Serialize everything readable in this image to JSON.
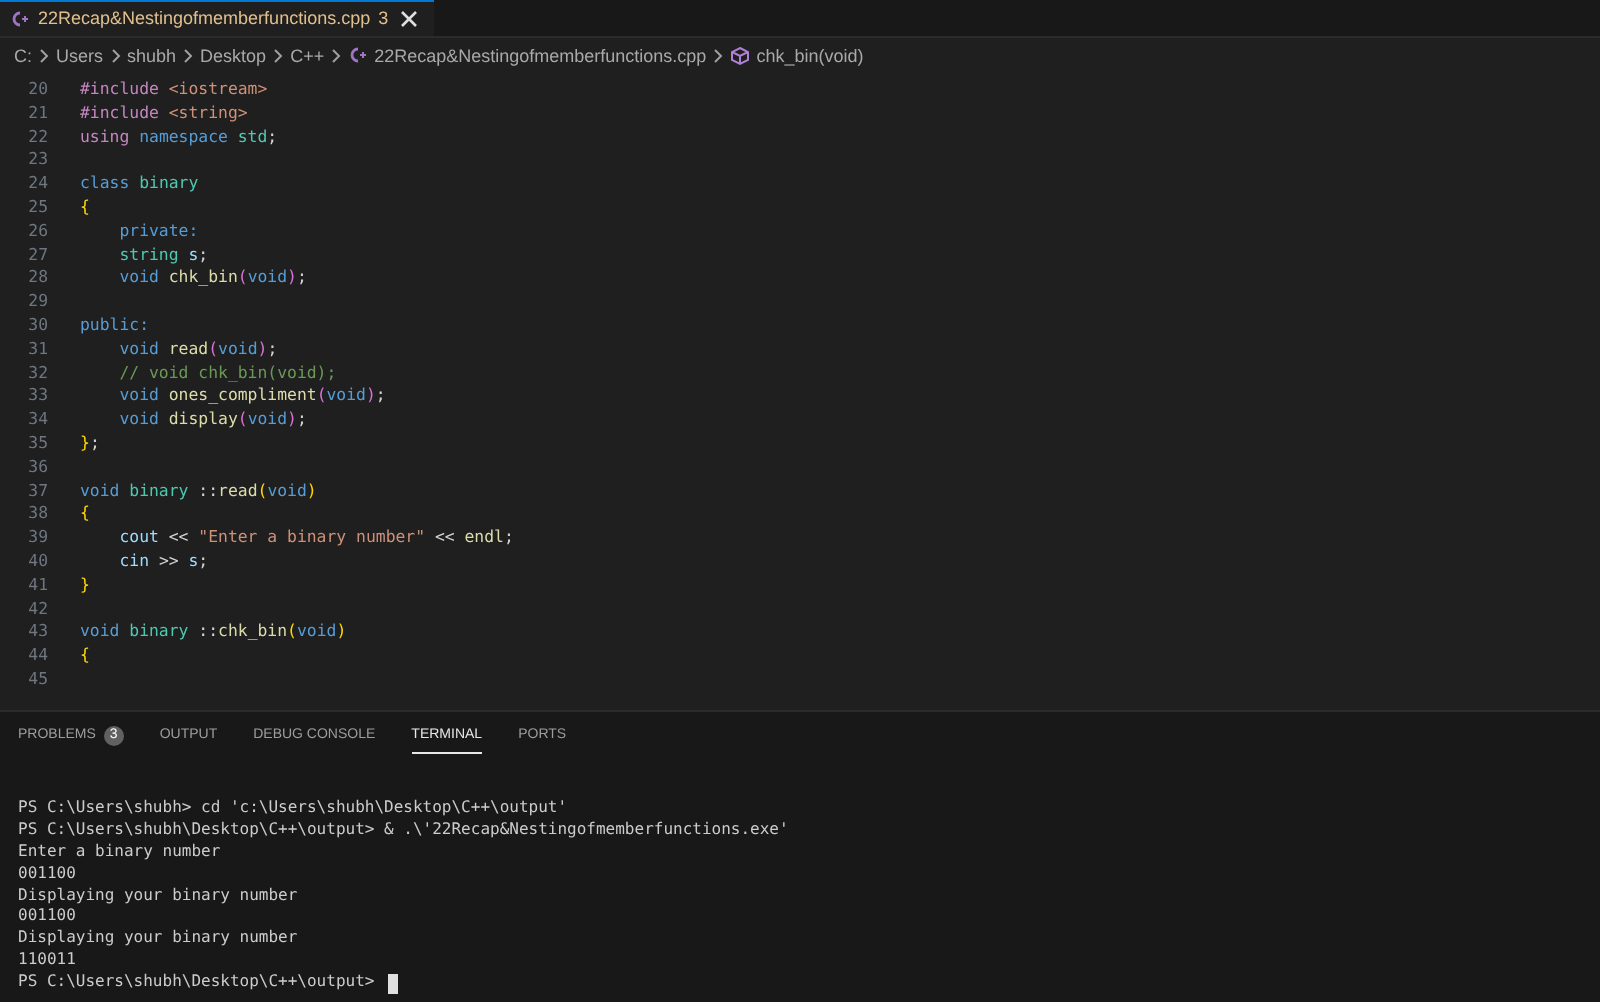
{
  "editor_tabs": [
    {
      "label": "22Recap&Nestingofmemberfunctions.cpp",
      "problem_count": "3",
      "selected": true
    }
  ],
  "breadcrumbs": [
    {
      "label": "C:",
      "kind": "folder"
    },
    {
      "label": "Users",
      "kind": "folder"
    },
    {
      "label": "shubh",
      "kind": "folder"
    },
    {
      "label": "Desktop",
      "kind": "folder"
    },
    {
      "label": "C++",
      "kind": "folder"
    },
    {
      "label": "22Recap&Nestingofmemberfunctions.cpp",
      "kind": "file"
    },
    {
      "label": "chk_bin(void)",
      "kind": "symbol"
    }
  ],
  "code_lines": [
    {
      "number": "20",
      "tokens": [
        {
          "text": "#include",
          "kind": "directive"
        },
        {
          "text": " <iostream>",
          "kind": "string"
        }
      ]
    },
    {
      "number": "21",
      "tokens": [
        {
          "text": "#include",
          "kind": "directive"
        },
        {
          "text": " <string>",
          "kind": "string"
        }
      ]
    },
    {
      "number": "22",
      "tokens": [
        {
          "text": "using",
          "kind": "directive"
        },
        {
          "text": " namespace",
          "kind": "keyword"
        },
        {
          "text": " std",
          "kind": "type"
        },
        {
          "text": ";",
          "kind": "plain"
        }
      ]
    },
    {
      "number": "23"
    },
    {
      "number": "24",
      "tokens": [
        {
          "text": "class",
          "kind": "keyword"
        },
        {
          "text": " binary",
          "kind": "type"
        }
      ]
    },
    {
      "number": "25",
      "tokens": [
        {
          "text": "{",
          "kind": "bracket1"
        }
      ]
    },
    {
      "number": "26",
      "tokens": [
        {
          "text": "    private:",
          "kind": "keyword"
        }
      ]
    },
    {
      "number": "27",
      "tokens": [
        {
          "text": "    string",
          "kind": "type"
        },
        {
          "text": " s",
          "kind": "variable"
        },
        {
          "text": ";",
          "kind": "plain"
        }
      ]
    },
    {
      "number": "28",
      "tokens": [
        {
          "text": "    void",
          "kind": "keyword"
        },
        {
          "text": " chk_bin",
          "kind": "function"
        },
        {
          "text": "(",
          "kind": "bracket2"
        },
        {
          "text": "void",
          "kind": "keyword"
        },
        {
          "text": ")",
          "kind": "bracket2"
        },
        {
          "text": ";",
          "kind": "plain"
        }
      ]
    },
    {
      "number": "29"
    },
    {
      "number": "30",
      "tokens": [
        {
          "text": "public:",
          "kind": "keyword"
        }
      ]
    },
    {
      "number": "31",
      "tokens": [
        {
          "text": "    void",
          "kind": "keyword"
        },
        {
          "text": " read",
          "kind": "function"
        },
        {
          "text": "(",
          "kind": "bracket2"
        },
        {
          "text": "void",
          "kind": "keyword"
        },
        {
          "text": ")",
          "kind": "bracket2"
        },
        {
          "text": ";",
          "kind": "plain"
        }
      ]
    },
    {
      "number": "32",
      "tokens": [
        {
          "text": "    // void chk_bin(void);",
          "kind": "comment"
        }
      ]
    },
    {
      "number": "33",
      "tokens": [
        {
          "text": "    void",
          "kind": "keyword"
        },
        {
          "text": " ones_compliment",
          "kind": "function"
        },
        {
          "text": "(",
          "kind": "bracket2"
        },
        {
          "text": "void",
          "kind": "keyword"
        },
        {
          "text": ")",
          "kind": "bracket2"
        },
        {
          "text": ";",
          "kind": "plain"
        }
      ]
    },
    {
      "number": "34",
      "tokens": [
        {
          "text": "    void",
          "kind": "keyword"
        },
        {
          "text": " display",
          "kind": "function"
        },
        {
          "text": "(",
          "kind": "bracket2"
        },
        {
          "text": "void",
          "kind": "keyword"
        },
        {
          "text": ")",
          "kind": "bracket2"
        },
        {
          "text": ";",
          "kind": "plain"
        }
      ]
    },
    {
      "number": "35",
      "tokens": [
        {
          "text": "}",
          "kind": "bracket1"
        },
        {
          "text": ";",
          "kind": "plain"
        }
      ]
    },
    {
      "number": "36"
    },
    {
      "number": "37",
      "tokens": [
        {
          "text": "void",
          "kind": "keyword"
        },
        {
          "text": " binary",
          "kind": "type"
        },
        {
          "text": " ::",
          "kind": "plain"
        },
        {
          "text": "read",
          "kind": "function"
        },
        {
          "text": "(",
          "kind": "bracket1"
        },
        {
          "text": "void",
          "kind": "keyword"
        },
        {
          "text": ")",
          "kind": "bracket1"
        }
      ]
    },
    {
      "number": "38",
      "tokens": [
        {
          "text": "{",
          "kind": "bracket1"
        }
      ]
    },
    {
      "number": "39",
      "tokens": [
        {
          "text": "    cout",
          "kind": "variable"
        },
        {
          "text": " << ",
          "kind": "plain"
        },
        {
          "text": "\"Enter a binary number\"",
          "kind": "string"
        },
        {
          "text": " << ",
          "kind": "plain"
        },
        {
          "text": "endl",
          "kind": "function"
        },
        {
          "text": ";",
          "kind": "plain"
        }
      ]
    },
    {
      "number": "40",
      "tokens": [
        {
          "text": "    cin",
          "kind": "variable"
        },
        {
          "text": " >> ",
          "kind": "plain"
        },
        {
          "text": "s",
          "kind": "variable"
        },
        {
          "text": ";",
          "kind": "plain"
        }
      ]
    },
    {
      "number": "41",
      "tokens": [
        {
          "text": "}",
          "kind": "bracket1"
        }
      ]
    },
    {
      "number": "42"
    },
    {
      "number": "43",
      "tokens": [
        {
          "text": "void",
          "kind": "keyword"
        },
        {
          "text": " binary",
          "kind": "type"
        },
        {
          "text": " ::",
          "kind": "plain"
        },
        {
          "text": "chk_bin",
          "kind": "function"
        },
        {
          "text": "(",
          "kind": "bracket1"
        },
        {
          "text": "void",
          "kind": "keyword"
        },
        {
          "text": ")",
          "kind": "bracket1"
        }
      ]
    },
    {
      "number": "44",
      "tokens": [
        {
          "text": "{",
          "kind": "bracket1"
        }
      ]
    },
    {
      "number": "45"
    }
  ],
  "panel_tabs": [
    {
      "label": "PROBLEMS",
      "badge": "3",
      "selected": false
    },
    {
      "label": "OUTPUT",
      "selected": false
    },
    {
      "label": "DEBUG CONSOLE",
      "selected": false
    },
    {
      "label": "TERMINAL",
      "selected": true
    },
    {
      "label": "PORTS",
      "selected": false
    }
  ],
  "terminal_lines": [
    "PS C:\\Users\\shubh> cd 'c:\\Users\\shubh\\Desktop\\C++\\output'",
    "PS C:\\Users\\shubh\\Desktop\\C++\\output> & .\\'22Recap&Nestingofmemberfunctions.exe'",
    "Enter a binary number",
    "001100",
    "Displaying your binary number",
    "001100",
    "Displaying your binary number",
    "110011",
    "PS C:\\Users\\shubh\\Desktop\\C++\\output> "
  ],
  "terminal_cursor": true
}
